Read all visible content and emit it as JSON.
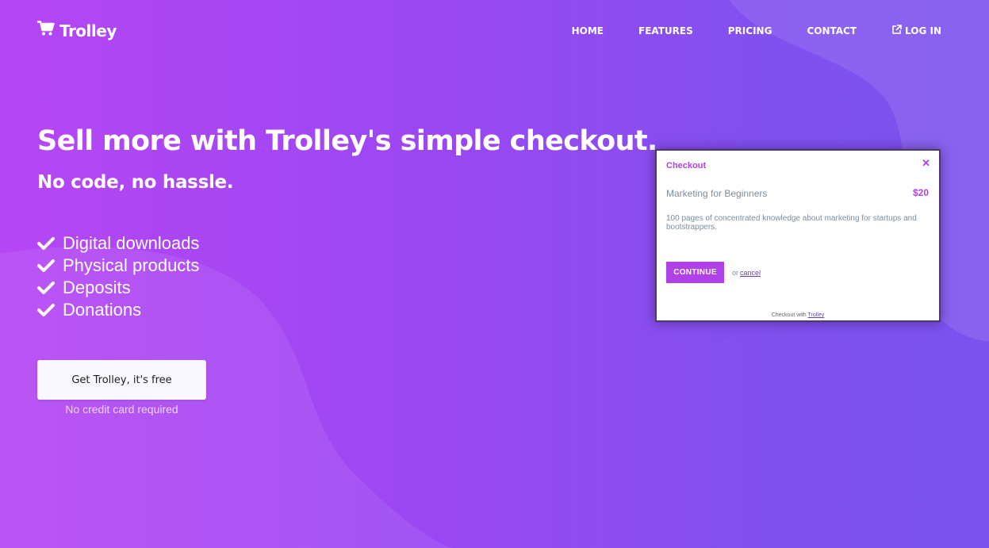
{
  "brand": {
    "name": "Trolley",
    "icon": "cart-icon"
  },
  "nav": {
    "items": [
      {
        "label": "HOME"
      },
      {
        "label": "FEATURES"
      },
      {
        "label": "PRICING"
      },
      {
        "label": "CONTACT"
      },
      {
        "label": "LOG IN",
        "icon": "external-link-icon"
      }
    ]
  },
  "hero": {
    "headline": "Sell more with Trolley's simple checkout.",
    "subheadline": "No code, no hassle.",
    "features": [
      {
        "label": "Digital downloads",
        "icon": "check-icon"
      },
      {
        "label": "Physical products",
        "icon": "check-icon"
      },
      {
        "label": "Deposits",
        "icon": "check-icon"
      },
      {
        "label": "Donations",
        "icon": "check-icon"
      }
    ],
    "cta_label": "Get Trolley, it's free",
    "cta_note": "No credit card required"
  },
  "checkout_preview": {
    "title": "Checkout",
    "close_icon": "close-icon",
    "product_name": "Marketing for Beginners",
    "price": "$20",
    "description": "100 pages of concentrated knowledge about marketing for startups and bootstrappers.",
    "continue_label": "CONTINUE",
    "or_text": "or",
    "cancel_label": "cancel",
    "footer_text": "Checkout with",
    "footer_link": "Trolley"
  },
  "colors": {
    "background_start": "#b646f5",
    "background_end": "#7a52ee",
    "accent": "#b040e8",
    "cta_background": "#f8f7ff"
  }
}
